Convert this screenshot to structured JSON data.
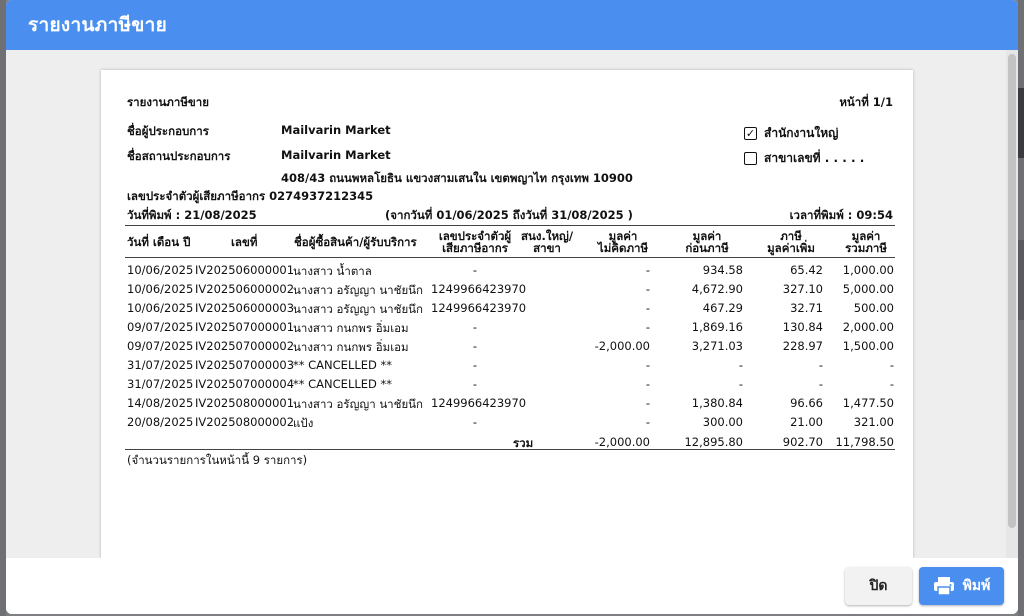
{
  "modal": {
    "title": "รายงานภาษีขาย"
  },
  "report": {
    "name": "รายงานภาษีขาย",
    "page": "หน้าที่ 1/1",
    "operator_label": "ชื่อผู้ประกอบการ",
    "operator_value": "Mailvarin Market",
    "place_label": "ชื่อสถานประกอบการ",
    "place_value": "Mailvarin Market",
    "address": "408/43 ถนนพหลโยธิน แขวงสามเสนใน เขตพญาไท กรุงเทพ 10900",
    "taxid": "เลขประจำตัวผู้เสียภาษีอากร 0274937212345",
    "print_date": "วันที่พิมพ์ : 21/08/2025",
    "period": "(จากวันที่ 01/06/2025 ถึงวันที่ 31/08/2025 )",
    "print_time": "เวลาที่พิมพ์ : 09:54",
    "hq": {
      "label": "สำนักงานใหญ่",
      "checked": true,
      "mark": "✓"
    },
    "branch": {
      "label": "สาขาเลขที่ . . . . .",
      "checked": false
    },
    "headers": {
      "date": "วันที่ เดือน ปี",
      "no": "เลขที่",
      "buyer": "ชื่อผู้ซื้อสินค้า/ผู้รับบริการ",
      "taxid1": "เลขประจำตัวผู้",
      "taxid2": "เสียภาษีอากร",
      "branch1": "สนง.ใหญ่/",
      "branch2": "สาขา",
      "nonvat1": "มูลค่า",
      "nonvat2": "ไม่คิดภาษี",
      "pre1": "มูลค่า",
      "pre2": "ก่อนภาษี",
      "vat1": "ภาษี",
      "vat2": "มูลค่าเพิ่ม",
      "total1": "มูลค่า",
      "total2": "รวมภาษี"
    },
    "rows": [
      {
        "date": "10/06/2025",
        "no": "IV202506000001",
        "buyer": "นางสาว น้ำตาล",
        "taxid": "-",
        "nonvat": "-",
        "pre": "934.58",
        "vat": "65.42",
        "total": "1,000.00"
      },
      {
        "date": "10/06/2025",
        "no": "IV202506000002",
        "buyer": "นางสาว อรัญญา นาชัยนึก",
        "taxid": "1249966423970",
        "nonvat": "-",
        "pre": "4,672.90",
        "vat": "327.10",
        "total": "5,000.00"
      },
      {
        "date": "10/06/2025",
        "no": "IV202506000003",
        "buyer": "นางสาว อรัญญา นาชัยนึก",
        "taxid": "1249966423970",
        "nonvat": "-",
        "pre": "467.29",
        "vat": "32.71",
        "total": "500.00"
      },
      {
        "date": "09/07/2025",
        "no": "IV202507000001",
        "buyer": "นางสาว กนกพร อิ่มเอม",
        "taxid": "-",
        "nonvat": "-",
        "pre": "1,869.16",
        "vat": "130.84",
        "total": "2,000.00"
      },
      {
        "date": "09/07/2025",
        "no": "IV202507000002",
        "buyer": "นางสาว กนกพร อิ่มเอม",
        "taxid": "-",
        "nonvat": "-2,000.00",
        "pre": "3,271.03",
        "vat": "228.97",
        "total": "1,500.00"
      },
      {
        "date": "31/07/2025",
        "no": "IV202507000003",
        "buyer": "** CANCELLED **",
        "taxid": "-",
        "nonvat": "-",
        "pre": "-",
        "vat": "-",
        "total": "-"
      },
      {
        "date": "31/07/2025",
        "no": "IV202507000004",
        "buyer": "** CANCELLED **",
        "taxid": "-",
        "nonvat": "-",
        "pre": "-",
        "vat": "-",
        "total": "-"
      },
      {
        "date": "14/08/2025",
        "no": "IV202508000001",
        "buyer": "นางสาว อรัญญา นาชัยนึก",
        "taxid": "1249966423970",
        "nonvat": "-",
        "pre": "1,380.84",
        "vat": "96.66",
        "total": "1,477.50"
      },
      {
        "date": "20/08/2025",
        "no": "IV202508000002",
        "buyer": "แป้ง",
        "taxid": "-",
        "nonvat": "-",
        "pre": "300.00",
        "vat": "21.00",
        "total": "321.00"
      }
    ],
    "totals": {
      "label": "รวม",
      "nonvat": "-2,000.00",
      "pre": "12,895.80",
      "vat": "902.70",
      "total": "11,798.50"
    },
    "count_note": "(จำนวนรายการในหน้านี้ 9 รายการ)"
  },
  "buttons": {
    "close": "ปิด",
    "print": "พิมพ์"
  },
  "icons": {
    "print": "printer-icon",
    "check": "check-icon"
  },
  "colors": {
    "header": "#4a8ff0",
    "print_button": "#4a8ff0"
  }
}
